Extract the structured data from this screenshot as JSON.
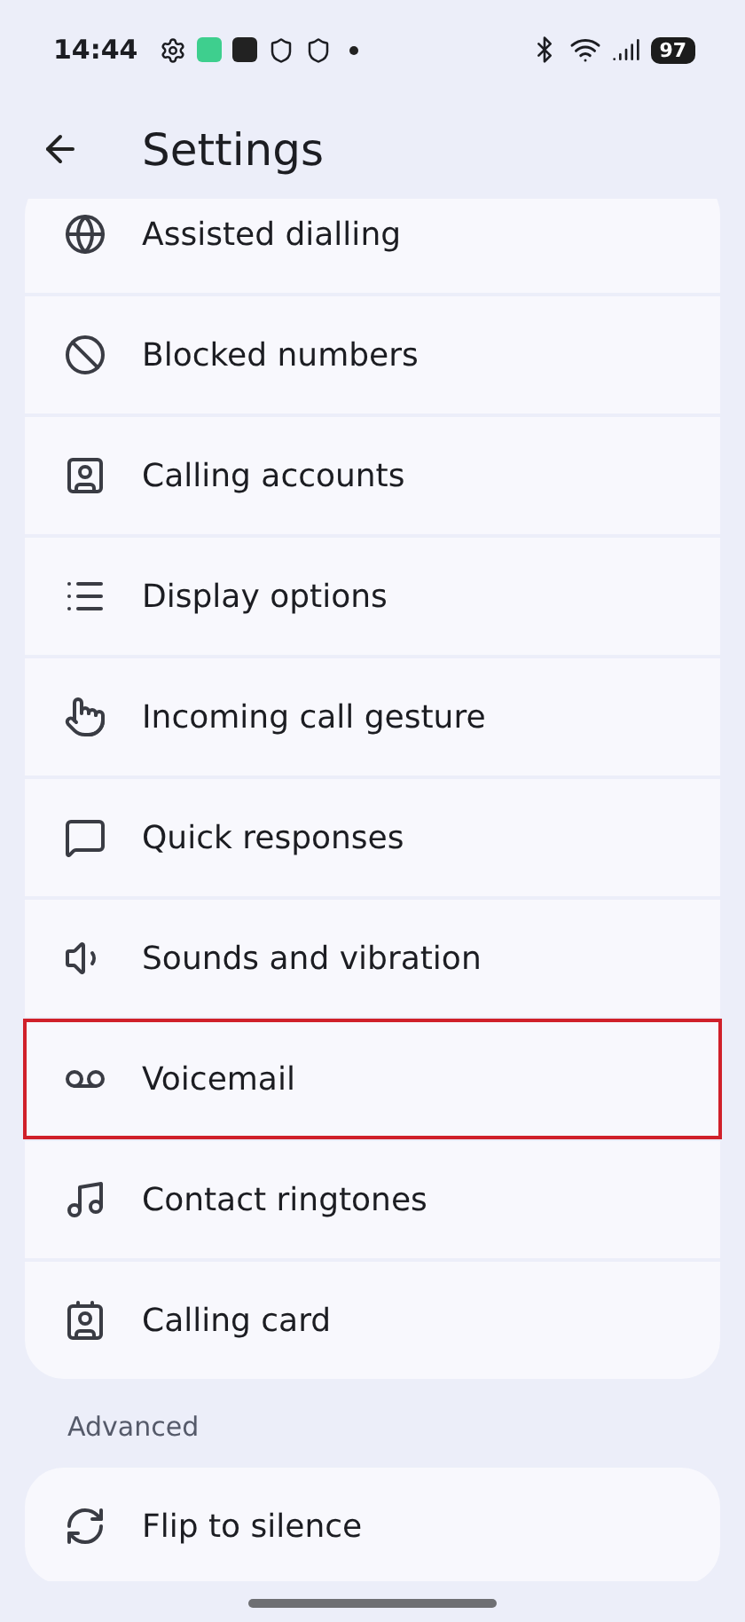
{
  "status_bar": {
    "time": "14:44",
    "battery": "97"
  },
  "header": {
    "title": "Settings"
  },
  "groups": [
    {
      "items": [
        {
          "label": "Assisted dialling",
          "kind": "globe",
          "highlighted": false
        },
        {
          "label": "Blocked numbers",
          "kind": "block",
          "highlighted": false
        },
        {
          "label": "Calling accounts",
          "kind": "account",
          "highlighted": false
        },
        {
          "label": "Display options",
          "kind": "list",
          "highlighted": false
        },
        {
          "label": "Incoming call gesture",
          "kind": "gesture",
          "highlighted": false
        },
        {
          "label": "Quick responses",
          "kind": "message",
          "highlighted": false
        },
        {
          "label": "Sounds and vibration",
          "kind": "sound",
          "highlighted": false
        },
        {
          "label": "Voicemail",
          "kind": "voicemail",
          "highlighted": true
        },
        {
          "label": "Contact ringtones",
          "kind": "ringtone",
          "highlighted": false
        },
        {
          "label": "Calling card",
          "kind": "card",
          "highlighted": false
        }
      ]
    },
    {
      "title": "Advanced",
      "items": [
        {
          "label": "Flip to silence",
          "kind": "flip",
          "highlighted": false
        }
      ]
    }
  ]
}
